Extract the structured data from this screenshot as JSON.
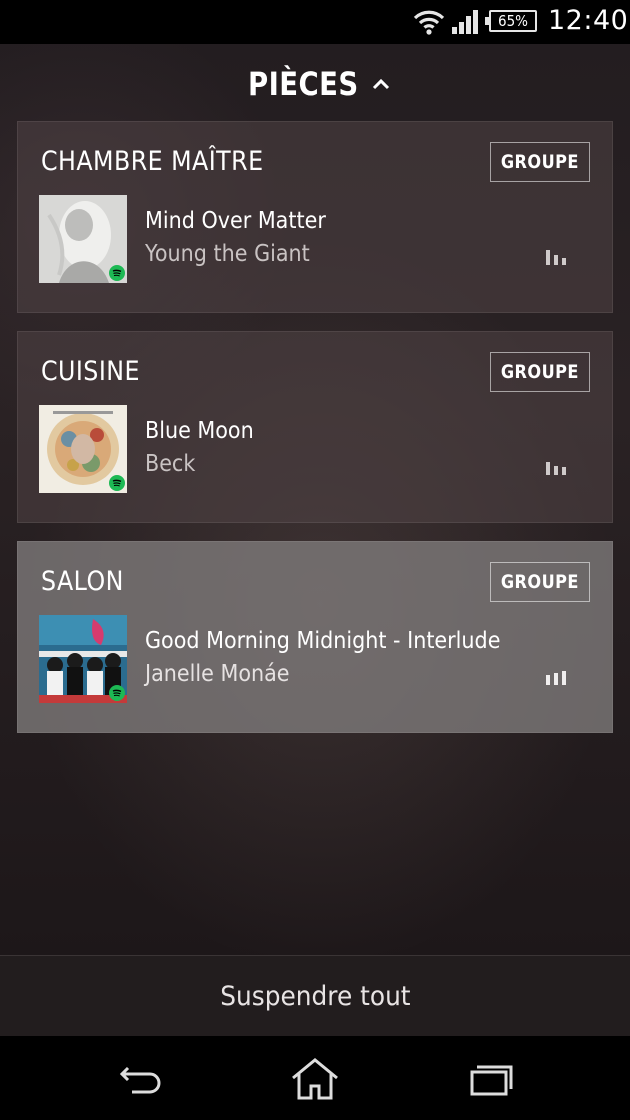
{
  "status_bar": {
    "battery_text": "65%",
    "battery_level": 0.65,
    "time": "12:40",
    "icons": [
      "wifi-icon",
      "signal-icon",
      "battery-icon"
    ]
  },
  "header": {
    "title": "PIÈCES",
    "icon": "chevron-up-icon"
  },
  "rooms": [
    {
      "name": "CHAMBRE MAÎTRE",
      "group_label": "GROUPE",
      "track": "Mind Over Matter",
      "artist": "Young the Giant",
      "source_icon": "spotify-icon",
      "playing_icon": "equalizer-icon",
      "active": false
    },
    {
      "name": "CUISINE",
      "group_label": "GROUPE",
      "track": "Blue Moon",
      "artist": "Beck",
      "source_icon": "spotify-icon",
      "playing_icon": "equalizer-icon",
      "active": false
    },
    {
      "name": "SALON",
      "group_label": "GROUPE",
      "track": "Good Morning Midnight - Interlude",
      "artist": "Janelle Monáe",
      "source_icon": "spotify-icon",
      "playing_icon": "equalizer-icon",
      "active": true
    }
  ],
  "bottom": {
    "pause_all_label": "Suspendre tout"
  },
  "nav": {
    "icons": [
      "back-icon",
      "home-icon",
      "recent-apps-icon"
    ]
  },
  "colors": {
    "active_card": "#807c7c",
    "card": "#504446",
    "spotify": "#1db954",
    "background": "#231d20"
  }
}
